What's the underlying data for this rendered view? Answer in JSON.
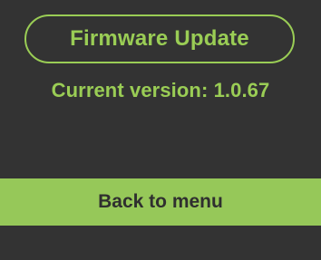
{
  "header": {
    "title": "Firmware Update"
  },
  "status": {
    "current_version": "Current version: 1.0.67"
  },
  "actions": {
    "back_label": "Back to menu"
  },
  "colors": {
    "background": "#333333",
    "accent": "#9acd55",
    "button_fill": "#96c859",
    "button_text": "#2f2f2f"
  }
}
